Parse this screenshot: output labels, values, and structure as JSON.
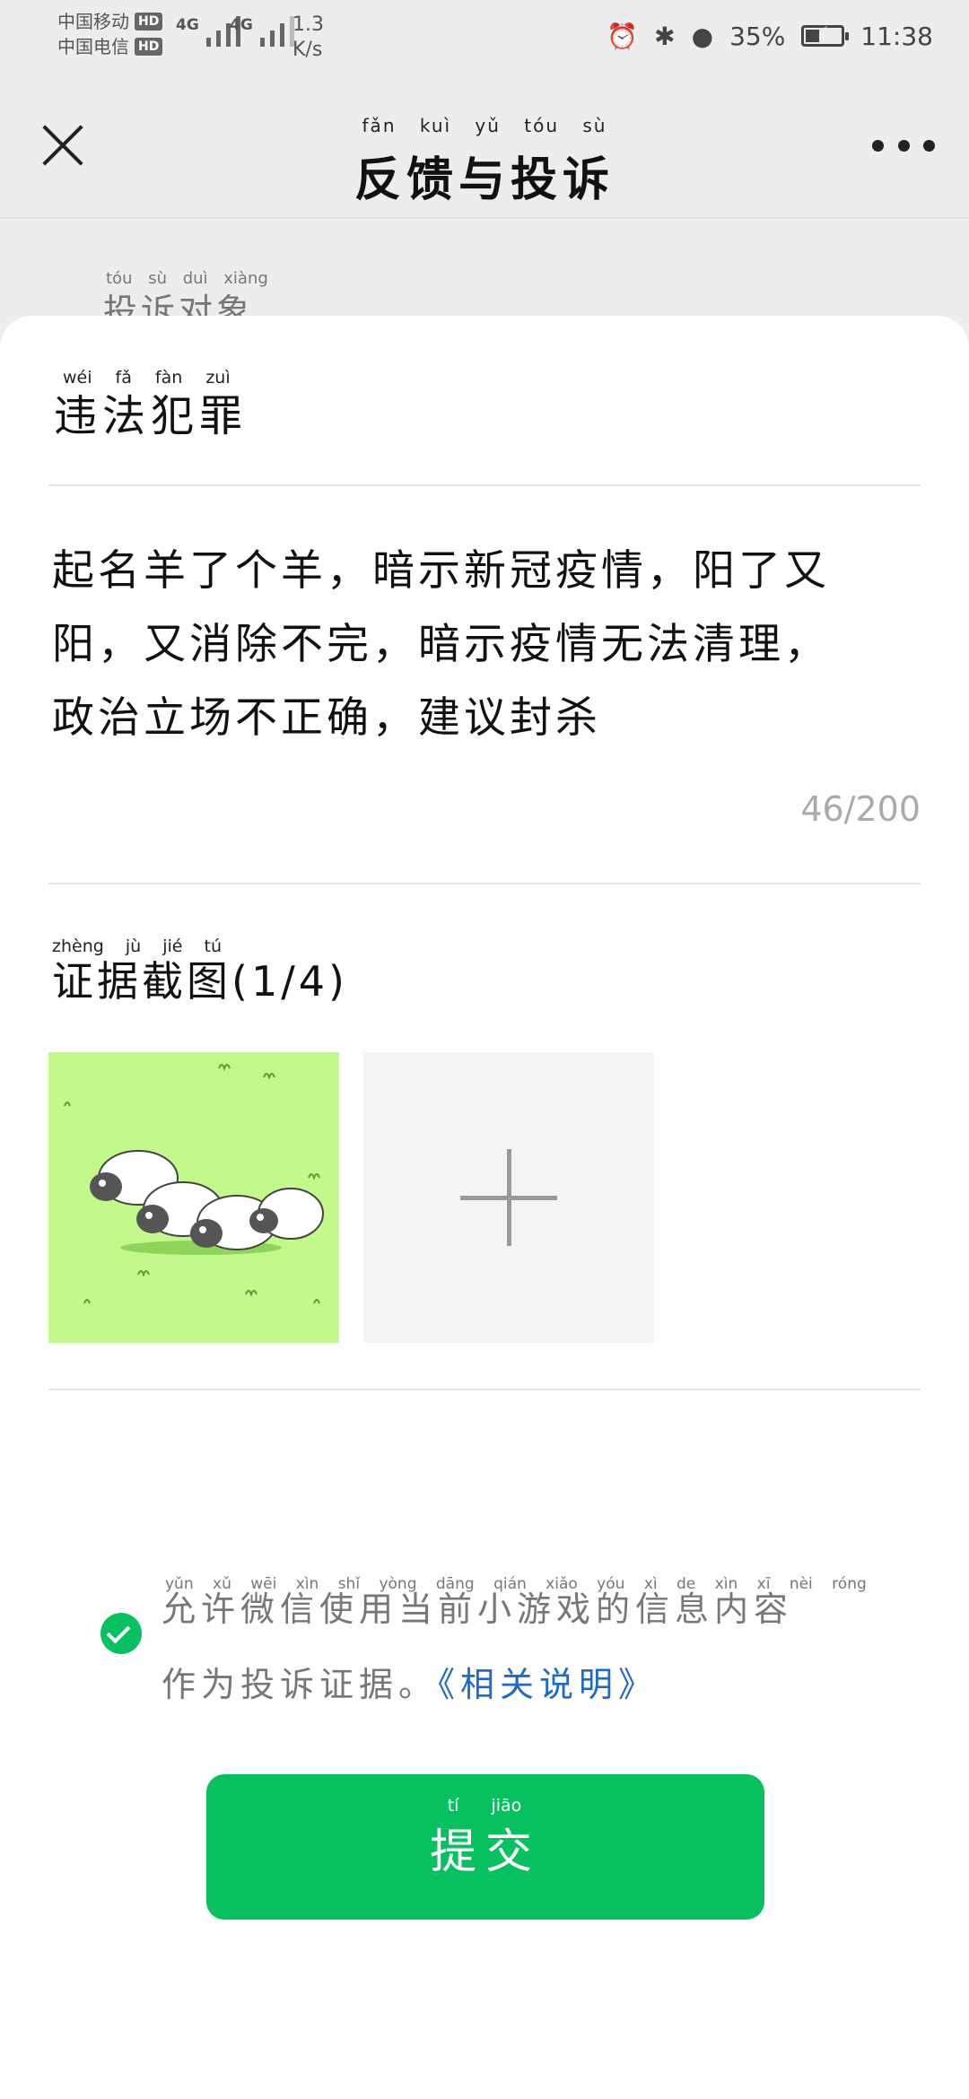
{
  "status_bar": {
    "carrier1": "中国移动",
    "carrier2": "中国电信",
    "hd": "HD",
    "net1": "4G",
    "net2": "4G",
    "speed": "1.3",
    "speed_unit": "K/s",
    "battery": "35%",
    "time": "11:38"
  },
  "nav": {
    "title": "反馈与投诉",
    "title_pinyin": "fǎn kuì yǔ tóu sù"
  },
  "section": {
    "label": "投诉对象",
    "label_pinyin": "tóu sù duì xiàng"
  },
  "form": {
    "type_value": "违法犯罪",
    "type_pinyin": "wéi fǎ fàn zuì",
    "description_lines": [
      "起名羊了个羊，暗示新冠疫情，阳了又",
      "阳，又消除不完，暗示疫情无法清理，",
      "政治立场不正确，建议封杀"
    ],
    "char_count": "46/200",
    "evidence_title": "证据截图(1/4)",
    "evidence_pinyin": "zhèng jù jié tú",
    "consent_line1": "允许微信使用当前小游戏的信息内容",
    "consent_line2": "作为投诉证据。",
    "consent_link": "《相关说明》",
    "consent_pinyin": "yǔn xǔ wēi xìn shǐ yòng dāng qián xiǎo yóu xì de xìn xī nèi róng",
    "submit_label": "提交",
    "submit_pinyin": "tí jiāo"
  },
  "colors": {
    "accent": "#07c160",
    "link": "#1e6ac5",
    "thumb_bg": "#c3f88a"
  },
  "icons": {
    "close": "close-icon",
    "more": "more-icon",
    "add": "add-image-icon",
    "check": "check-icon"
  }
}
